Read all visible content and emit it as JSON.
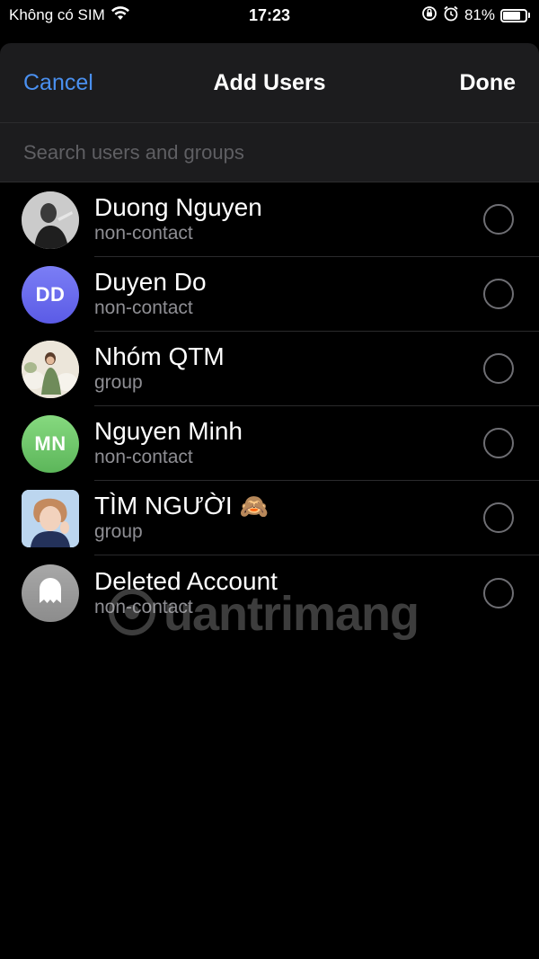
{
  "status_bar": {
    "carrier": "Không có SIM",
    "time": "17:23",
    "battery_percent": "81%",
    "battery_level": 0.81,
    "icons": [
      "wifi-icon",
      "orientation-lock-icon",
      "alarm-icon",
      "battery-icon"
    ]
  },
  "nav": {
    "cancel_label": "Cancel",
    "title": "Add Users",
    "done_label": "Done"
  },
  "search": {
    "placeholder": "Search users and groups",
    "value": ""
  },
  "users": [
    {
      "name": "Duong Nguyen",
      "subtitle": "non-contact",
      "avatar": "photo",
      "avatar_color": "#3a3a3a"
    },
    {
      "name": "Duyen Do",
      "subtitle": "non-contact",
      "avatar": "initials",
      "initials": "DD",
      "avatar_color": "#6a6cf0"
    },
    {
      "name": "Nhóm QTM",
      "subtitle": "group",
      "avatar": "photo",
      "avatar_color": "#c9b9a0"
    },
    {
      "name": "Nguyen Minh",
      "subtitle": "non-contact",
      "avatar": "initials",
      "initials": "MN",
      "avatar_color": "#6cc66a"
    },
    {
      "name": "TÌM NGƯỜI",
      "emoji": "🙈",
      "subtitle": "group",
      "avatar": "photo",
      "avatar_color": "#9fc4e8"
    },
    {
      "name": "Deleted Account",
      "subtitle": "non-contact",
      "avatar": "ghost",
      "avatar_color": "#9a9a9a"
    }
  ],
  "watermark": "uantrimang",
  "colors": {
    "accent": "#4a90f0",
    "background": "#000000",
    "sheet_header": "#1c1c1e",
    "secondary_text": "#8e8e93"
  }
}
